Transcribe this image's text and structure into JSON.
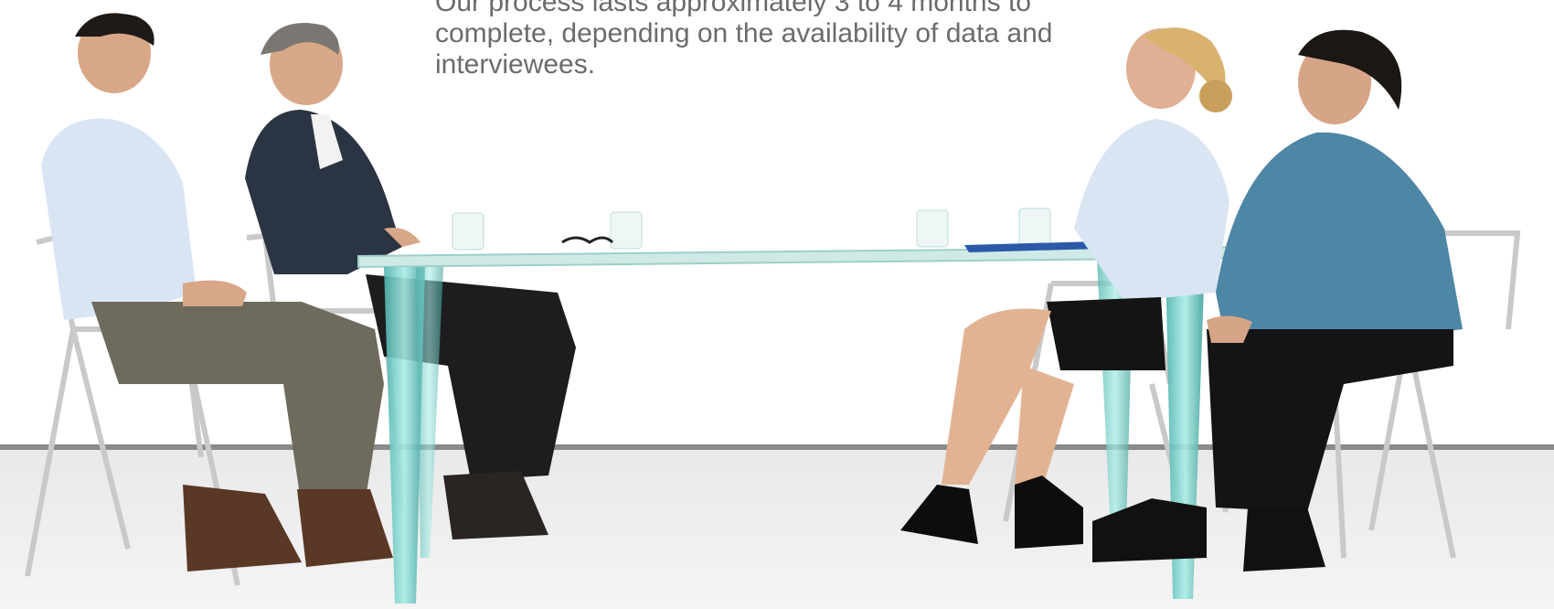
{
  "caption": {
    "lines": [
      "Our process lasts approximately 3 to 4 months to",
      "complete, depending on the availability of data and",
      "interviewees."
    ]
  },
  "colors": {
    "wall": "#ffffff",
    "floor": "#ececec",
    "baseboard": "#8a8a8a",
    "glass": "#7fd6cf",
    "caption_text": "#6b6b6b"
  }
}
